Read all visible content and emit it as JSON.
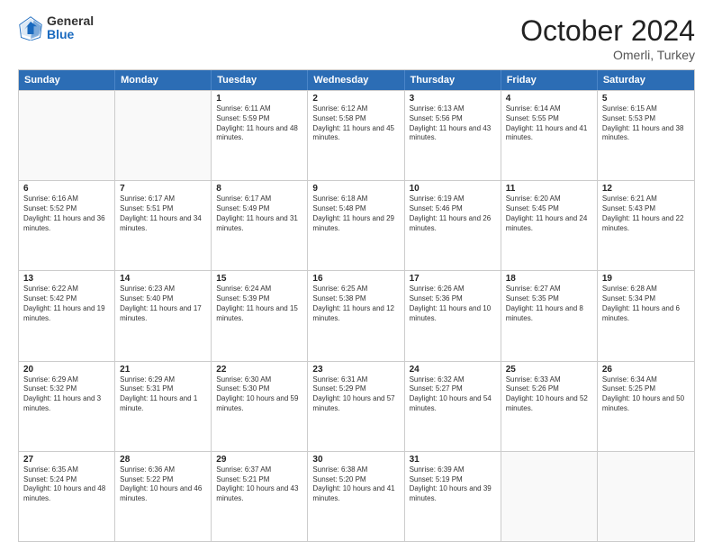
{
  "header": {
    "logo_general": "General",
    "logo_blue": "Blue",
    "month_title": "October 2024",
    "subtitle": "Omerli, Turkey"
  },
  "days_of_week": [
    "Sunday",
    "Monday",
    "Tuesday",
    "Wednesday",
    "Thursday",
    "Friday",
    "Saturday"
  ],
  "weeks": [
    [
      {
        "day": "",
        "empty": true
      },
      {
        "day": "",
        "empty": true
      },
      {
        "day": "1",
        "sunrise": "Sunrise: 6:11 AM",
        "sunset": "Sunset: 5:59 PM",
        "daylight": "Daylight: 11 hours and 48 minutes."
      },
      {
        "day": "2",
        "sunrise": "Sunrise: 6:12 AM",
        "sunset": "Sunset: 5:58 PM",
        "daylight": "Daylight: 11 hours and 45 minutes."
      },
      {
        "day": "3",
        "sunrise": "Sunrise: 6:13 AM",
        "sunset": "Sunset: 5:56 PM",
        "daylight": "Daylight: 11 hours and 43 minutes."
      },
      {
        "day": "4",
        "sunrise": "Sunrise: 6:14 AM",
        "sunset": "Sunset: 5:55 PM",
        "daylight": "Daylight: 11 hours and 41 minutes."
      },
      {
        "day": "5",
        "sunrise": "Sunrise: 6:15 AM",
        "sunset": "Sunset: 5:53 PM",
        "daylight": "Daylight: 11 hours and 38 minutes."
      }
    ],
    [
      {
        "day": "6",
        "sunrise": "Sunrise: 6:16 AM",
        "sunset": "Sunset: 5:52 PM",
        "daylight": "Daylight: 11 hours and 36 minutes."
      },
      {
        "day": "7",
        "sunrise": "Sunrise: 6:17 AM",
        "sunset": "Sunset: 5:51 PM",
        "daylight": "Daylight: 11 hours and 34 minutes."
      },
      {
        "day": "8",
        "sunrise": "Sunrise: 6:17 AM",
        "sunset": "Sunset: 5:49 PM",
        "daylight": "Daylight: 11 hours and 31 minutes."
      },
      {
        "day": "9",
        "sunrise": "Sunrise: 6:18 AM",
        "sunset": "Sunset: 5:48 PM",
        "daylight": "Daylight: 11 hours and 29 minutes."
      },
      {
        "day": "10",
        "sunrise": "Sunrise: 6:19 AM",
        "sunset": "Sunset: 5:46 PM",
        "daylight": "Daylight: 11 hours and 26 minutes."
      },
      {
        "day": "11",
        "sunrise": "Sunrise: 6:20 AM",
        "sunset": "Sunset: 5:45 PM",
        "daylight": "Daylight: 11 hours and 24 minutes."
      },
      {
        "day": "12",
        "sunrise": "Sunrise: 6:21 AM",
        "sunset": "Sunset: 5:43 PM",
        "daylight": "Daylight: 11 hours and 22 minutes."
      }
    ],
    [
      {
        "day": "13",
        "sunrise": "Sunrise: 6:22 AM",
        "sunset": "Sunset: 5:42 PM",
        "daylight": "Daylight: 11 hours and 19 minutes."
      },
      {
        "day": "14",
        "sunrise": "Sunrise: 6:23 AM",
        "sunset": "Sunset: 5:40 PM",
        "daylight": "Daylight: 11 hours and 17 minutes."
      },
      {
        "day": "15",
        "sunrise": "Sunrise: 6:24 AM",
        "sunset": "Sunset: 5:39 PM",
        "daylight": "Daylight: 11 hours and 15 minutes."
      },
      {
        "day": "16",
        "sunrise": "Sunrise: 6:25 AM",
        "sunset": "Sunset: 5:38 PM",
        "daylight": "Daylight: 11 hours and 12 minutes."
      },
      {
        "day": "17",
        "sunrise": "Sunrise: 6:26 AM",
        "sunset": "Sunset: 5:36 PM",
        "daylight": "Daylight: 11 hours and 10 minutes."
      },
      {
        "day": "18",
        "sunrise": "Sunrise: 6:27 AM",
        "sunset": "Sunset: 5:35 PM",
        "daylight": "Daylight: 11 hours and 8 minutes."
      },
      {
        "day": "19",
        "sunrise": "Sunrise: 6:28 AM",
        "sunset": "Sunset: 5:34 PM",
        "daylight": "Daylight: 11 hours and 6 minutes."
      }
    ],
    [
      {
        "day": "20",
        "sunrise": "Sunrise: 6:29 AM",
        "sunset": "Sunset: 5:32 PM",
        "daylight": "Daylight: 11 hours and 3 minutes."
      },
      {
        "day": "21",
        "sunrise": "Sunrise: 6:29 AM",
        "sunset": "Sunset: 5:31 PM",
        "daylight": "Daylight: 11 hours and 1 minute."
      },
      {
        "day": "22",
        "sunrise": "Sunrise: 6:30 AM",
        "sunset": "Sunset: 5:30 PM",
        "daylight": "Daylight: 10 hours and 59 minutes."
      },
      {
        "day": "23",
        "sunrise": "Sunrise: 6:31 AM",
        "sunset": "Sunset: 5:29 PM",
        "daylight": "Daylight: 10 hours and 57 minutes."
      },
      {
        "day": "24",
        "sunrise": "Sunrise: 6:32 AM",
        "sunset": "Sunset: 5:27 PM",
        "daylight": "Daylight: 10 hours and 54 minutes."
      },
      {
        "day": "25",
        "sunrise": "Sunrise: 6:33 AM",
        "sunset": "Sunset: 5:26 PM",
        "daylight": "Daylight: 10 hours and 52 minutes."
      },
      {
        "day": "26",
        "sunrise": "Sunrise: 6:34 AM",
        "sunset": "Sunset: 5:25 PM",
        "daylight": "Daylight: 10 hours and 50 minutes."
      }
    ],
    [
      {
        "day": "27",
        "sunrise": "Sunrise: 6:35 AM",
        "sunset": "Sunset: 5:24 PM",
        "daylight": "Daylight: 10 hours and 48 minutes."
      },
      {
        "day": "28",
        "sunrise": "Sunrise: 6:36 AM",
        "sunset": "Sunset: 5:22 PM",
        "daylight": "Daylight: 10 hours and 46 minutes."
      },
      {
        "day": "29",
        "sunrise": "Sunrise: 6:37 AM",
        "sunset": "Sunset: 5:21 PM",
        "daylight": "Daylight: 10 hours and 43 minutes."
      },
      {
        "day": "30",
        "sunrise": "Sunrise: 6:38 AM",
        "sunset": "Sunset: 5:20 PM",
        "daylight": "Daylight: 10 hours and 41 minutes."
      },
      {
        "day": "31",
        "sunrise": "Sunrise: 6:39 AM",
        "sunset": "Sunset: 5:19 PM",
        "daylight": "Daylight: 10 hours and 39 minutes."
      },
      {
        "day": "",
        "empty": true
      },
      {
        "day": "",
        "empty": true
      }
    ]
  ]
}
